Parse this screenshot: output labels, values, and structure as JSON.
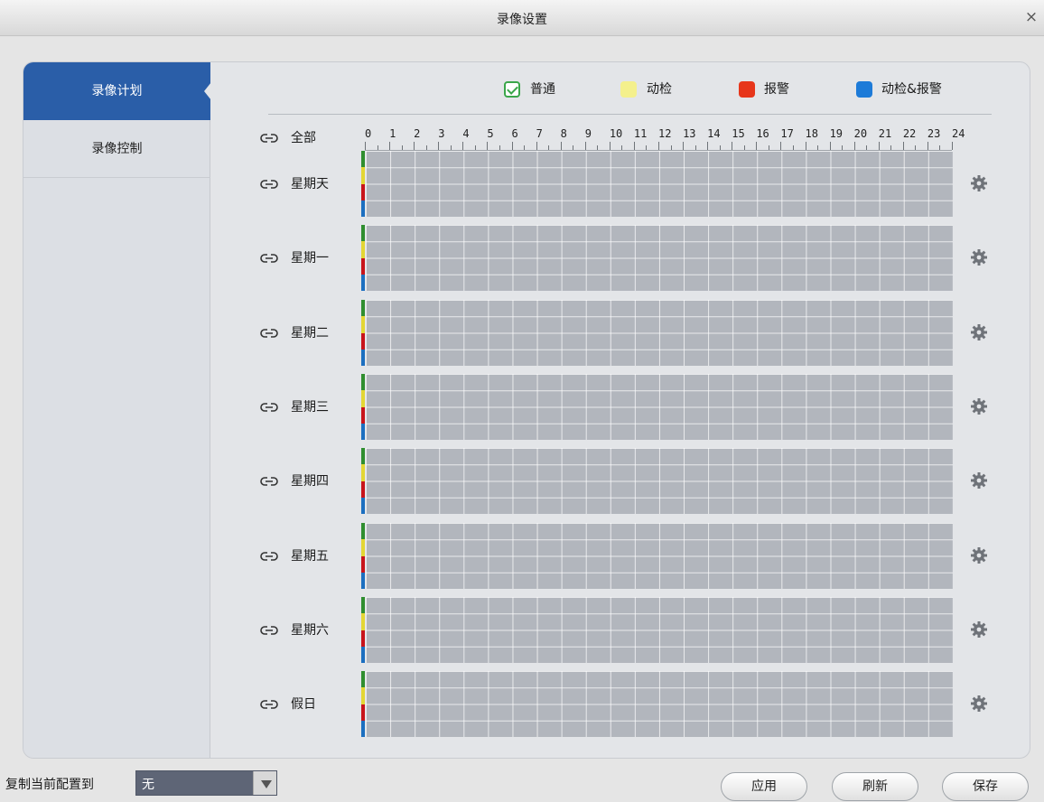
{
  "window": {
    "title": "录像设置"
  },
  "sidebar": {
    "items": [
      {
        "label": "录像计划",
        "active": true
      },
      {
        "label": "录像控制",
        "active": false
      }
    ]
  },
  "legend": {
    "items": [
      {
        "label": "普通",
        "color": "#3aa64a",
        "icon": "checkbox-checked-icon"
      },
      {
        "label": "动检",
        "color": "#f4f08c"
      },
      {
        "label": "报警",
        "color": "#e7361b"
      },
      {
        "label": "动检&报警",
        "color": "#1d7bd8"
      }
    ]
  },
  "schedule": {
    "all_label": "全部",
    "hours": [
      "0",
      "1",
      "2",
      "3",
      "4",
      "5",
      "6",
      "7",
      "8",
      "9",
      "10",
      "11",
      "12",
      "13",
      "14",
      "15",
      "16",
      "17",
      "18",
      "19",
      "20",
      "21",
      "22",
      "23",
      "24"
    ],
    "days": [
      "星期天",
      "星期一",
      "星期二",
      "星期三",
      "星期四",
      "星期五",
      "星期六",
      "假日"
    ],
    "strip_colors": [
      "#2f8e2f",
      "#e3d634",
      "#c8141b",
      "#1c6fc0"
    ],
    "grid_color": "#b2b6bd"
  },
  "footer": {
    "copy_label": "复制当前配置到",
    "copy_select_value": "无",
    "buttons": {
      "apply": "应用",
      "refresh": "刷新",
      "save": "保存"
    }
  }
}
